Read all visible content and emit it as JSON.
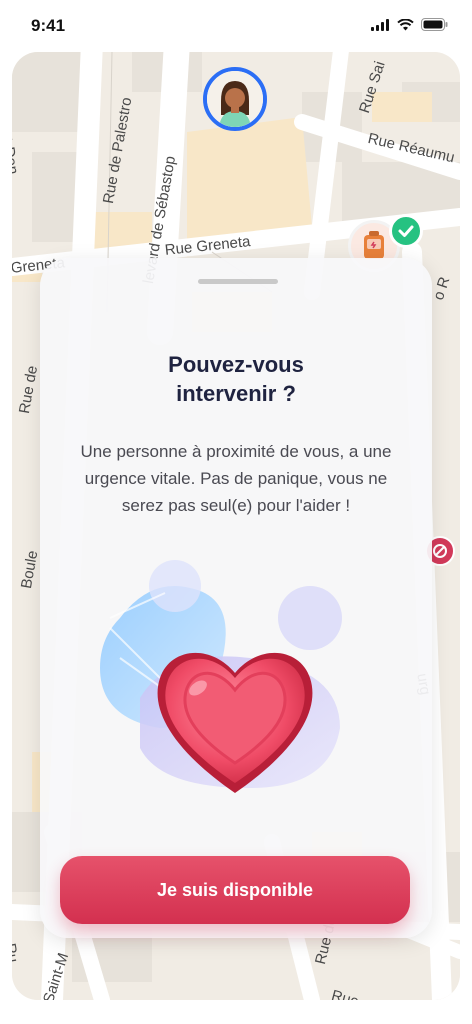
{
  "status_bar": {
    "time": "9:41"
  },
  "map": {
    "streets": {
      "palestro": "Rue de Palestro",
      "sebastopol": "levard de Sébastop",
      "greneta": "Rue Greneta",
      "greneta_left": "Greneta",
      "reaumur": "Rue Réaumu",
      "saint": "Rue Sai",
      "saint_denis": "Saint-Den",
      "left_rue": "Rue de",
      "boule": "Boule",
      "right_o": "o R",
      "right_burg": "urg",
      "bottom_ru": "Ru",
      "bottom_saint_m": "Saint-M",
      "bottom_rue_de": "Rue de",
      "bottom_rue": "Rue"
    }
  },
  "modal": {
    "title": "Pouvez-vous intervenir ?",
    "body": "Une personne à proximité de vous, a une urgence vitale. Pas de panique, vous ne serez pas seul(e) pour l'aider !",
    "cta_label": "Je suis disponible"
  },
  "colors": {
    "accent": "#d3304f",
    "title": "#1f2340",
    "avatar_ring": "#2b6ef5",
    "check": "#26c281"
  },
  "icons": [
    "signal-icon",
    "wifi-icon",
    "battery-icon",
    "user-avatar-icon",
    "aed-marker-icon",
    "check-icon",
    "ban-icon",
    "heart-illustration"
  ]
}
